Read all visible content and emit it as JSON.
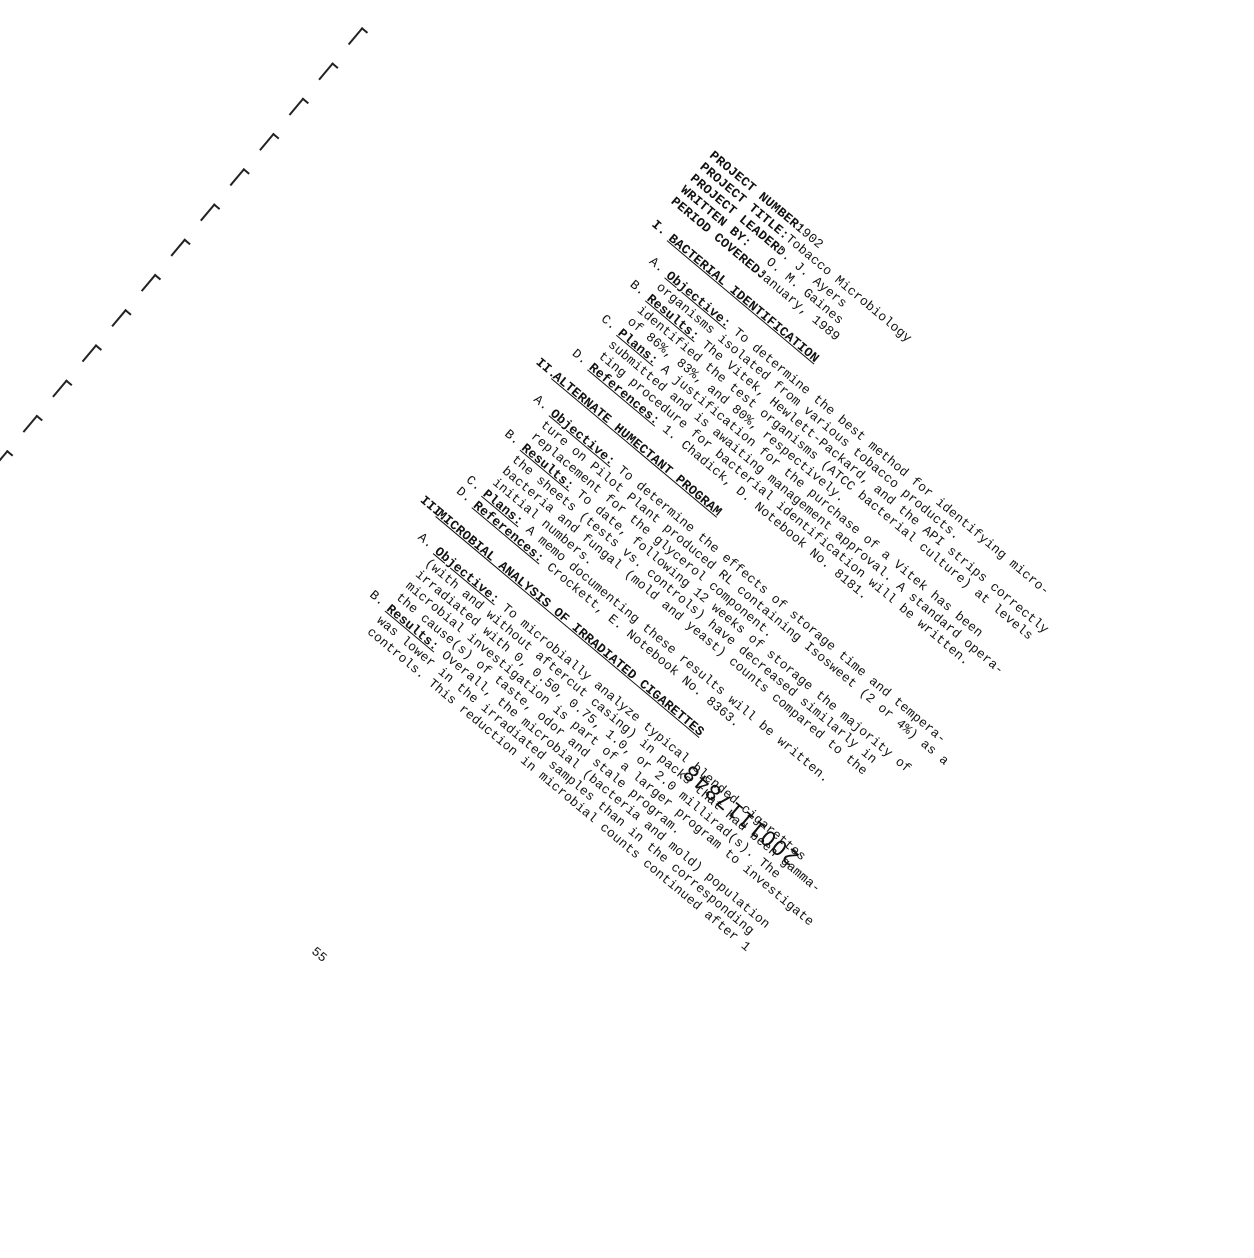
{
  "header": {
    "project_number_label": "PROJECT NUMBER:",
    "project_number": "1902",
    "project_title_label": "PROJECT TITLE:",
    "project_title": "Tobacco Microbiology",
    "project_leader_label": "PROJECT LEADER:",
    "project_leader": "D. J. Ayers",
    "written_by_label": "WRITTEN BY:",
    "written_by": "O. M. Gaines",
    "period_label": "PERIOD COVERED:",
    "period": "January, 1989"
  },
  "sections": [
    {
      "num": "I.",
      "title": "BACTERIAL IDENTIFICATION",
      "items": [
        {
          "letter": "A.",
          "label": "Objective:",
          "lines": [
            "To determine the best method for identifying micro-",
            "organisms isolated from various tobacco products."
          ]
        },
        {
          "letter": "B.",
          "label": "Results:",
          "lines": [
            "The Vitek, Hewlett-Packard, and the API strips correctly",
            "identified the test organisms (ATCC bacterial culture) at levels",
            "of 86%, 83%, and 80%, respectively."
          ]
        },
        {
          "letter": "C.",
          "label": "Plans:",
          "lines": [
            "A justification for the purchase of a Vitek has been",
            "submitted and is awaiting management approval. A standard opera-",
            "ting procedure for bacterial identification will be written."
          ]
        },
        {
          "letter": "D.",
          "label": "References:",
          "lines": [
            "1.  Chadick, D. Notebook No. 8181."
          ]
        }
      ]
    },
    {
      "num": "II.",
      "title": "ALTERNATE HUMECTANT PROGRAM",
      "items": [
        {
          "letter": "A.",
          "label": "Objective:",
          "lines": [
            "To determine the effects of storage time and tempera-",
            "ture on Pilot Plant produced RL containing Isosweet (2 or 4%) as a",
            "replacement for the glycerol component."
          ]
        },
        {
          "letter": "B.",
          "label": "Results:",
          "lines": [
            "To date, following 12 weeks of storage the majority of",
            "the sheets (tests vs. controls) have decreased similarly in",
            "bacteria and fungal (mold and yeast) counts compared to the",
            "initial numbers."
          ]
        },
        {
          "letter": "C.",
          "label": "Plans:",
          "lines": [
            "A memo documenting these results will be written."
          ]
        },
        {
          "letter": "D.",
          "label": "References:",
          "lines": [
            "Crockett, E. Notebook No. 8363."
          ]
        }
      ]
    },
    {
      "num": "III.",
      "title": "MICROBIAL ANALYSIS OF IRRADIATED CIGARETTES",
      "items": [
        {
          "letter": "A.",
          "label": "Objective:",
          "lines": [
            "To microbially analyze typical blended cigarettes",
            "(with and without aftercut casing) in packs that had been gamma-",
            "irradiated with 0, 0.50, 0.75, 1.0, or 2.0 millirad(s). The",
            "microbial investigation is part of a larger program to investigate",
            "the cause(s) of taste, odor and stale program."
          ]
        },
        {
          "letter": "B.",
          "label": "Results:",
          "lines": [
            "Overall, the microbial (bacteria and mold) population",
            "was lower in the irradiated samples than in the corresponding",
            "controls. This reduction in microbial counts continued after 1"
          ]
        }
      ]
    }
  ],
  "stamp": "2001117848",
  "page_number": "55"
}
